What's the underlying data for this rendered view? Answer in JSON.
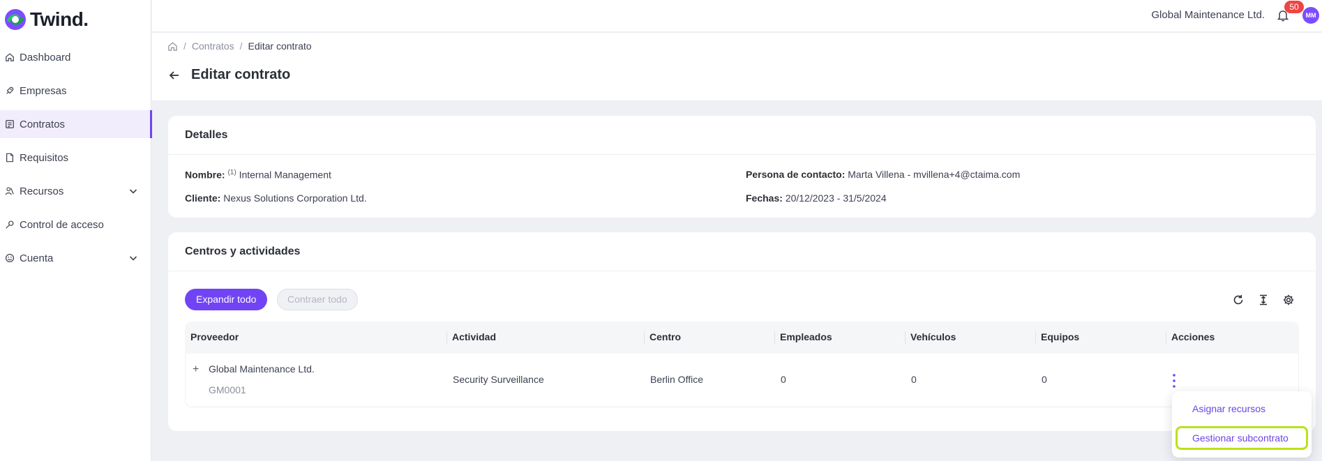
{
  "app": {
    "logo_text": "Twind."
  },
  "sidebar": {
    "items": [
      {
        "label": "Dashboard",
        "icon": "home-icon",
        "expandable": false,
        "active": false
      },
      {
        "label": "Empresas",
        "icon": "rocket-icon",
        "expandable": false,
        "active": false
      },
      {
        "label": "Contratos",
        "icon": "contract-icon",
        "expandable": false,
        "active": true
      },
      {
        "label": "Requisitos",
        "icon": "document-icon",
        "expandable": false,
        "active": false
      },
      {
        "label": "Recursos",
        "icon": "users-icon",
        "expandable": true,
        "active": false
      },
      {
        "label": "Control de acceso",
        "icon": "key-icon",
        "expandable": false,
        "active": false
      },
      {
        "label": "Cuenta",
        "icon": "smile-icon",
        "expandable": true,
        "active": false
      }
    ]
  },
  "topbar": {
    "company": "Global Maintenance Ltd.",
    "notifications": "50",
    "avatar_initials": "MM"
  },
  "breadcrumb": {
    "items": [
      "Contratos",
      "Editar contrato"
    ]
  },
  "page": {
    "title": "Editar contrato"
  },
  "details": {
    "heading": "Detalles",
    "nombre_label": "Nombre:",
    "nombre_sup": "(1)",
    "nombre_value": "Internal Management",
    "cliente_label": "Cliente:",
    "cliente_value": "Nexus Solutions Corporation Ltd.",
    "contacto_label": "Persona de contacto:",
    "contacto_value": "Marta Villena - mvillena+4@ctaima.com",
    "fechas_label": "Fechas:",
    "fechas_value": "20/12/2023 - 31/5/2024"
  },
  "centros": {
    "heading": "Centros y actividades",
    "expand_label": "Expandir todo",
    "collapse_label": "Contraer todo",
    "columns": [
      "Proveedor",
      "Actividad",
      "Centro",
      "Empleados",
      "Vehículos",
      "Equipos",
      "Acciones"
    ],
    "rows": [
      {
        "proveedor": "Global Maintenance Ltd.",
        "code": "GM0001",
        "actividad": "Security Surveillance",
        "centro": "Berlin Office",
        "empleados": "0",
        "vehiculos": "0",
        "equipos": "0"
      }
    ]
  },
  "actions_menu": {
    "items": [
      "Asignar recursos",
      "Gestionar subcontrato"
    ]
  },
  "colors": {
    "accent": "#7044f5",
    "highlight": "#b9e21a",
    "badge": "#ef4444"
  }
}
